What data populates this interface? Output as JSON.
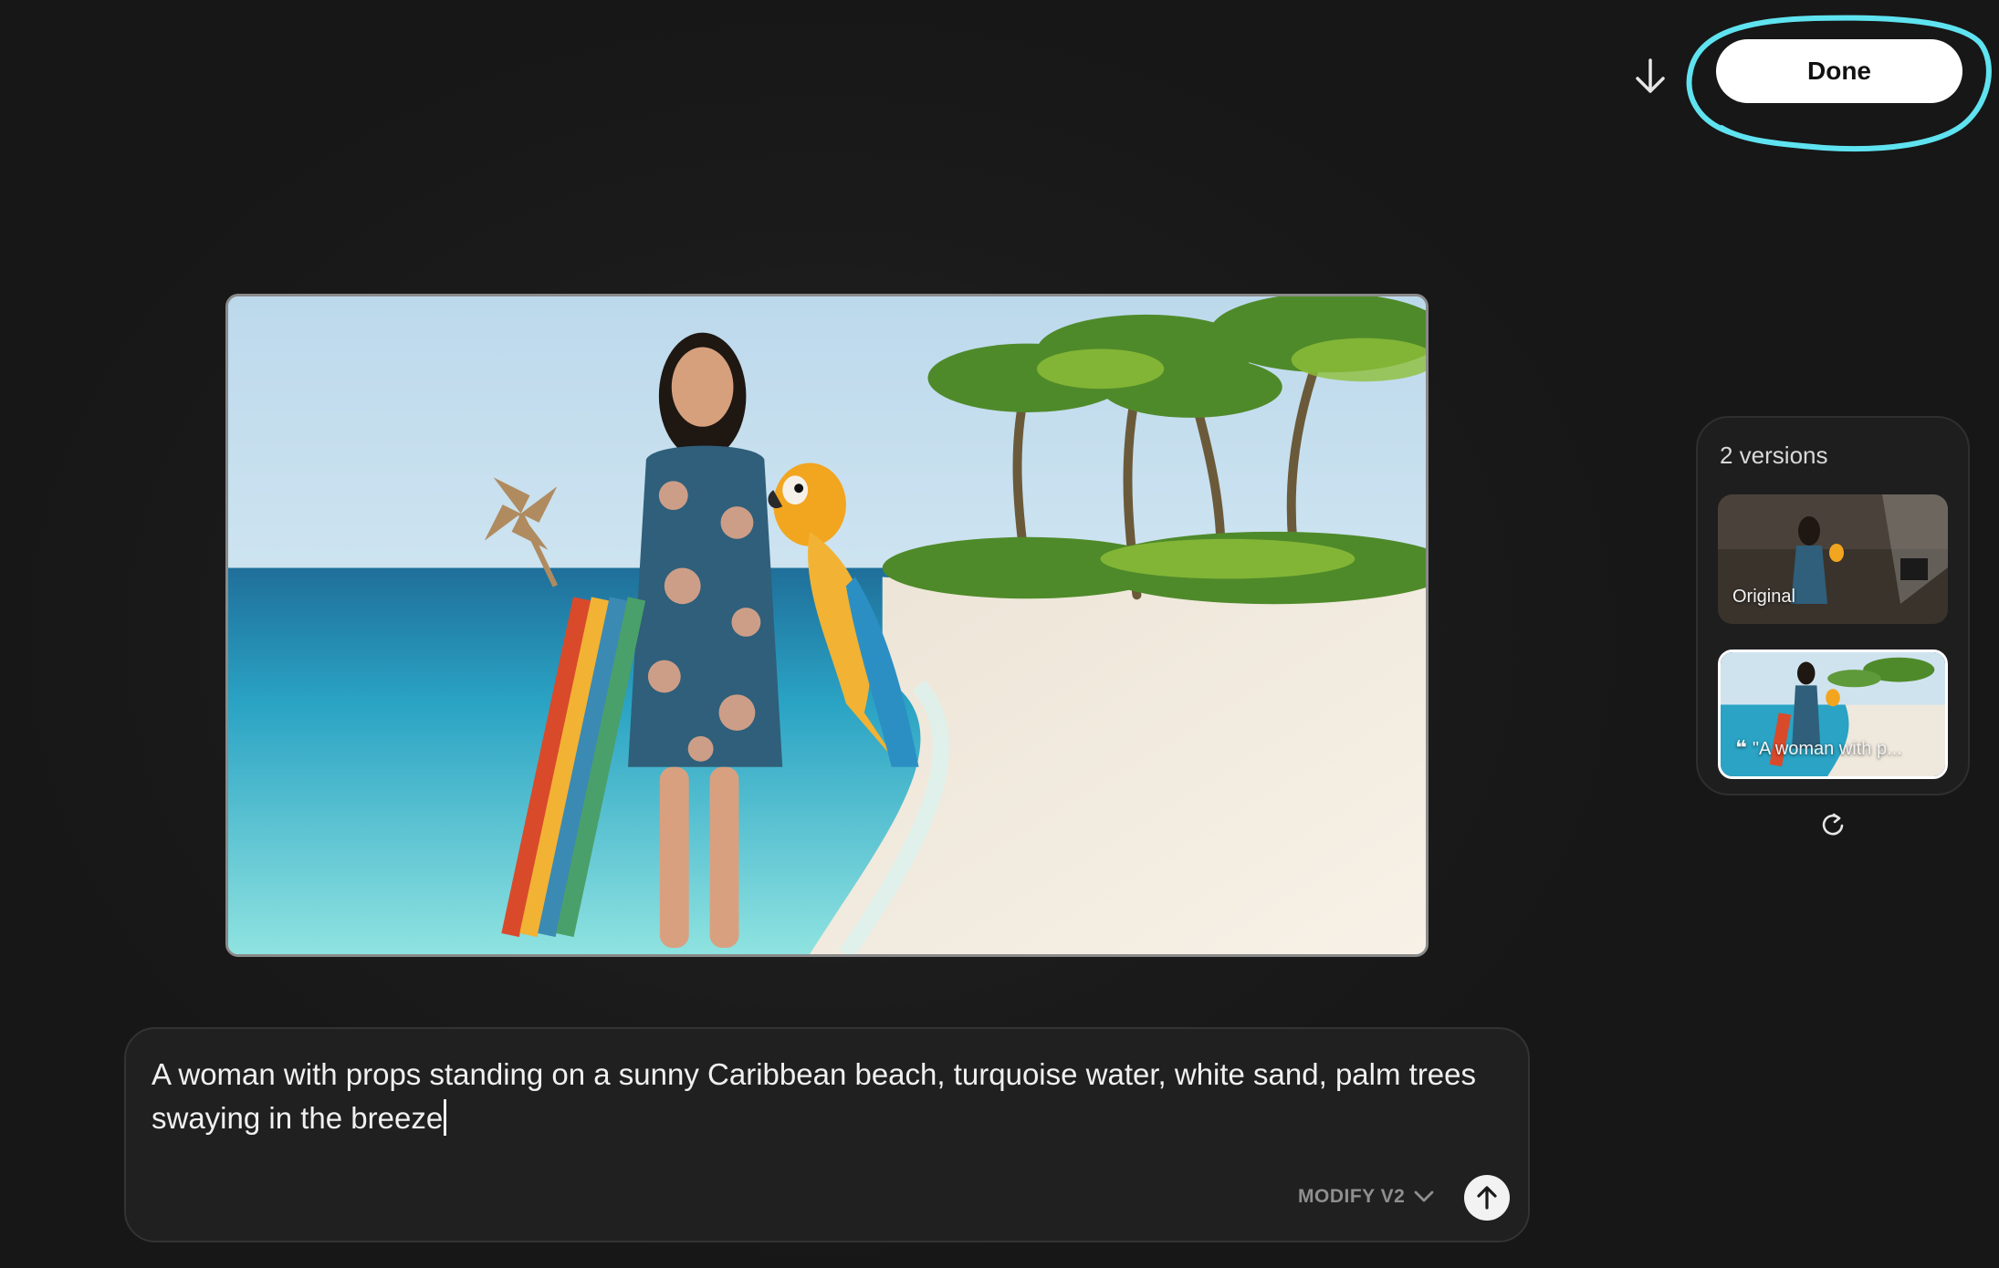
{
  "header": {
    "download_icon": "arrow-down-icon",
    "done_label": "Done"
  },
  "versions": {
    "title": "2 versions",
    "items": [
      {
        "label": "Original",
        "selected": false
      },
      {
        "label": "\"A woman with p...",
        "selected": true,
        "icon": "quote-icon"
      }
    ],
    "refresh_icon": "refresh-icon"
  },
  "prompt": {
    "text": "A woman with props standing on a sunny Caribbean beach, turquoise water, white sand, palm trees swaying in the breeze",
    "model_label": "MODIFY V2",
    "send_icon": "arrow-up-icon"
  },
  "colors": {
    "background": "#1a1a1a",
    "highlight": "#5fe3f0",
    "button": "#ffffff"
  }
}
